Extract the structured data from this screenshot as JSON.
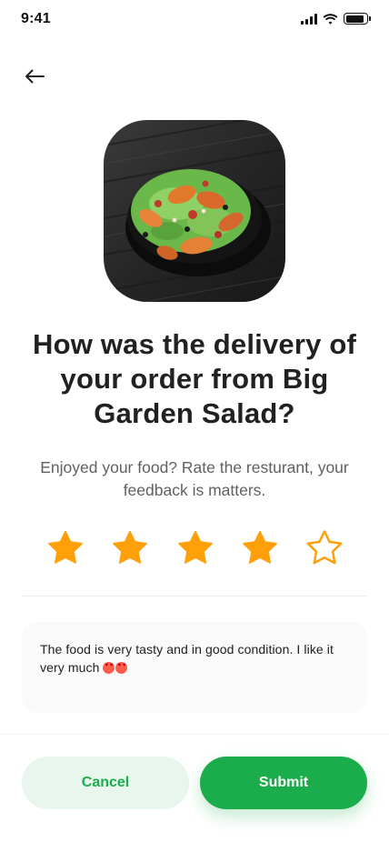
{
  "status_bar": {
    "time": "9:41",
    "battery_level": 0.9
  },
  "header": {
    "back_icon": "arrow-left-icon"
  },
  "food": {
    "image": "salad-bowl-photo"
  },
  "rating": {
    "title": "How was the delivery of your order from Big Garden Salad?",
    "subtitle": "Enjoyed your food? Rate the resturant, your feedback is matters.",
    "value": 4,
    "max": 5,
    "filled_color": "#FF9F0A",
    "icon": "star-icon"
  },
  "review": {
    "text": "The food is very tasty and in good condition. I like it very much",
    "emoji": "😍😍"
  },
  "actions": {
    "cancel_label": "Cancel",
    "submit_label": "Submit"
  },
  "colors": {
    "primary": "#1BAC4B",
    "primary_light": "#E8F6EE"
  }
}
